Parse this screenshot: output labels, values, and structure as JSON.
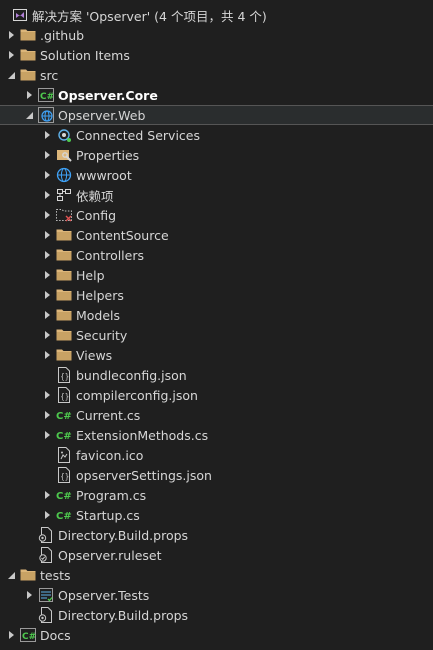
{
  "solution": {
    "title": "解决方案 'Opserver' (4 个项目，共 4 个)"
  },
  "items": [
    {
      "id": "github",
      "label": ".github",
      "icon": "folder-icon",
      "depth": 1,
      "chevron": "collapsed"
    },
    {
      "id": "solution-items",
      "label": "Solution Items",
      "icon": "folder-icon",
      "depth": 1,
      "chevron": "collapsed"
    },
    {
      "id": "src",
      "label": "src",
      "icon": "folder-icon",
      "depth": 1,
      "chevron": "expanded"
    },
    {
      "id": "opserver-core",
      "label": "Opserver.Core",
      "icon": "csharp-project-icon",
      "depth": 2,
      "chevron": "collapsed",
      "bold": true
    },
    {
      "id": "opserver-web",
      "label": "Opserver.Web",
      "icon": "web-project-icon",
      "depth": 2,
      "chevron": "expanded",
      "selected": true
    },
    {
      "id": "connected-services",
      "label": "Connected Services",
      "icon": "connected-services-icon",
      "depth": 3,
      "chevron": "collapsed"
    },
    {
      "id": "properties",
      "label": "Properties",
      "icon": "properties-icon",
      "depth": 3,
      "chevron": "collapsed"
    },
    {
      "id": "wwwroot",
      "label": "wwwroot",
      "icon": "globe-icon",
      "depth": 3,
      "chevron": "collapsed"
    },
    {
      "id": "dependencies",
      "label": "依赖项",
      "icon": "dependencies-icon",
      "depth": 3,
      "chevron": "collapsed"
    },
    {
      "id": "config",
      "label": "Config",
      "icon": "excluded-folder-icon",
      "depth": 3,
      "chevron": "collapsed"
    },
    {
      "id": "contentsource",
      "label": "ContentSource",
      "icon": "folder-icon",
      "depth": 3,
      "chevron": "collapsed"
    },
    {
      "id": "controllers",
      "label": "Controllers",
      "icon": "folder-icon",
      "depth": 3,
      "chevron": "collapsed"
    },
    {
      "id": "help",
      "label": "Help",
      "icon": "folder-icon",
      "depth": 3,
      "chevron": "collapsed"
    },
    {
      "id": "helpers",
      "label": "Helpers",
      "icon": "folder-icon",
      "depth": 3,
      "chevron": "collapsed"
    },
    {
      "id": "models",
      "label": "Models",
      "icon": "folder-icon",
      "depth": 3,
      "chevron": "collapsed"
    },
    {
      "id": "security",
      "label": "Security",
      "icon": "folder-icon",
      "depth": 3,
      "chevron": "collapsed"
    },
    {
      "id": "views",
      "label": "Views",
      "icon": "folder-icon",
      "depth": 3,
      "chevron": "collapsed"
    },
    {
      "id": "bundleconfig",
      "label": "bundleconfig.json",
      "icon": "json-file-icon",
      "depth": 3,
      "chevron": "none"
    },
    {
      "id": "compilerconfig",
      "label": "compilerconfig.json",
      "icon": "json-file-icon",
      "depth": 3,
      "chevron": "collapsed"
    },
    {
      "id": "current-cs",
      "label": "Current.cs",
      "icon": "csharp-file-icon",
      "depth": 3,
      "chevron": "collapsed"
    },
    {
      "id": "extensionmethods-cs",
      "label": "ExtensionMethods.cs",
      "icon": "csharp-file-icon",
      "depth": 3,
      "chevron": "collapsed"
    },
    {
      "id": "favicon",
      "label": "favicon.ico",
      "icon": "image-file-icon",
      "depth": 3,
      "chevron": "none"
    },
    {
      "id": "opserversettings",
      "label": "opserverSettings.json",
      "icon": "json-file-icon",
      "depth": 3,
      "chevron": "none"
    },
    {
      "id": "program-cs",
      "label": "Program.cs",
      "icon": "csharp-file-icon",
      "depth": 3,
      "chevron": "collapsed"
    },
    {
      "id": "startup-cs",
      "label": "Startup.cs",
      "icon": "csharp-file-icon",
      "depth": 3,
      "chevron": "collapsed"
    },
    {
      "id": "directory-build-props-src",
      "label": "Directory.Build.props",
      "icon": "props-file-icon",
      "depth": 2,
      "chevron": "none"
    },
    {
      "id": "opserver-ruleset",
      "label": "Opserver.ruleset",
      "icon": "ruleset-file-icon",
      "depth": 2,
      "chevron": "none"
    },
    {
      "id": "tests",
      "label": "tests",
      "icon": "folder-icon",
      "depth": 1,
      "chevron": "expanded"
    },
    {
      "id": "opserver-tests",
      "label": "Opserver.Tests",
      "icon": "test-project-icon",
      "depth": 2,
      "chevron": "collapsed"
    },
    {
      "id": "directory-build-props-tests",
      "label": "Directory.Build.props",
      "icon": "props-file-icon",
      "depth": 2,
      "chevron": "none"
    },
    {
      "id": "docs",
      "label": "Docs",
      "icon": "csharp-project-icon",
      "depth": 1,
      "chevron": "collapsed"
    }
  ],
  "colors": {
    "background": "#1f1f1f",
    "text": "#d6d6d6",
    "folder": "#dcb67a",
    "csharp": "#4ec94e",
    "globe": "#3fa2f7",
    "selected": "#2a2d2e",
    "solution": "#b180d7"
  }
}
